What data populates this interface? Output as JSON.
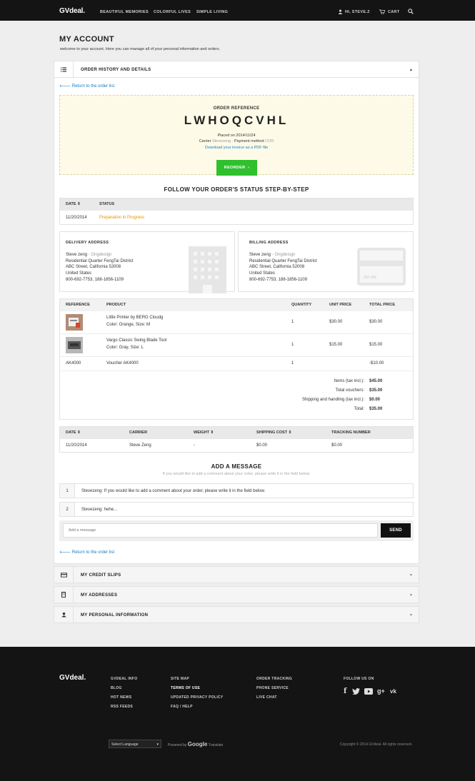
{
  "header": {
    "logo": "GVdeal.",
    "nav": [
      "BEAUTIFUL MEMORIES",
      "COLORFUL LIVES",
      "SIMPLE LIVING"
    ],
    "user": "HI, STEVE.Z",
    "cart": "CART"
  },
  "page": {
    "title": "MY ACCOUNT",
    "subtitle": "welcome to your account. Here you can manage all of your personal information and orders."
  },
  "order_section": {
    "title": "ORDER HISTORY AND DETAILS",
    "return_link": "Return to the order list",
    "reference_label": "ORDER REFERENCE",
    "reference": "LWHOQCVHL",
    "placed_on": "Placed on 2014/11/24",
    "carrier_label": "Carrier",
    "carrier_value": "Stevezeng",
    "payment_label": "Payment method",
    "payment_value": "COD",
    "invoice_link": "Download your invoice as a PDF file",
    "reorder": "REORDER"
  },
  "status": {
    "heading": "FOLLOW YOUR ORDER'S STATUS STEP-BY-STEP",
    "col_date": "DATE ⇕",
    "col_status": "STATUS",
    "date": "11/20/2014",
    "value": "Preparation in Progress"
  },
  "delivery": {
    "title": "DELIVERY ADDRESS",
    "name": "Steve zeng",
    "company": "Ongdesign",
    "line1": "Residential Quarter FengTai District",
    "line2": "ABC Street, California 52008",
    "country": "United States",
    "phone": "800-692-7753, 188-1856-1109"
  },
  "billing": {
    "title": "BILLING ADDRESS",
    "name": "Steve zeng",
    "company": "Ongdesign",
    "line1": "Residential Quarter FengTai District",
    "line2": "ABC Street, California 52008",
    "country": "United States",
    "phone": "800-692-7753, 188-1856-1109"
  },
  "products": {
    "headers": [
      "REFERENCE",
      "PRODUCT",
      "QUANTITY",
      "UNIT PRICE",
      "TOTAL PRICE"
    ],
    "rows": [
      {
        "name": "Little Printer by BERG Cloudg",
        "attrs": "Color: Orange,   Size: M",
        "qty": "1",
        "unit": "$30.00",
        "total": "$30.00"
      },
      {
        "name": "Vargo Classic Swing Blade Tool",
        "attrs": "Color: Gray,   Size: L",
        "qty": "1",
        "unit": "$15.00",
        "total": "$15.00"
      }
    ],
    "voucher": {
      "ref": "AK4000",
      "name": "Voucher AK4000",
      "qty": "1",
      "total": "-$10.00"
    },
    "totals": [
      {
        "label": "Items (tax incl.):",
        "value": "$45.00"
      },
      {
        "label": "Total vouchers:",
        "value": "$35.00"
      },
      {
        "label": "Shipping and handling (tax incl.):",
        "value": "$0.00"
      },
      {
        "label": "Total:",
        "value": "$35.00"
      }
    ]
  },
  "shipping": {
    "headers": [
      "DATE ⇕",
      "CARRIER",
      "WEIGHT ⇕",
      "SHIPPING COST ⇕",
      "TRACKING NUMBER"
    ],
    "row": [
      "11/20/2014",
      "Steve Zeng",
      "-",
      "$0.00",
      "$0.00"
    ]
  },
  "messages": {
    "heading": "ADD A MESSAGE",
    "hint": "If you would like to add a comment about your order, please write it in the field below.",
    "items": [
      {
        "num": "1",
        "text": "Stevezeng: If you would like to add a comment about your order, please write it in the field below."
      },
      {
        "num": "2",
        "text": "Stevezeng: hehe..."
      }
    ],
    "placeholder": "Add a message",
    "send": "SEND"
  },
  "return_link_bottom": "Return to the order list",
  "accordions": [
    "MY CREDIT SLIPS",
    "MY ADDRESSES",
    "MY PERSONAL INFORMATION"
  ],
  "footer": {
    "logo": "GVdeal.",
    "col1": [
      "GVDEAL INFO",
      "BLOG",
      "HOT NEWS",
      "RSS FEEDS"
    ],
    "col2": [
      "SITE MAP",
      "TERMS OF USE",
      "UPDATED PRIVACY POLICY",
      "FAQ / HELP"
    ],
    "col3": [
      "ORDER TRACKING",
      "PHONE SERVICE",
      "LIVE CHAT"
    ],
    "follow": "FOLLOW US ON",
    "language": "Select Language",
    "powered": "Powered by",
    "google": "Google",
    "translate": "Translate",
    "copyright": "Copyright © 2014 GVdeal. All rights reserved."
  }
}
